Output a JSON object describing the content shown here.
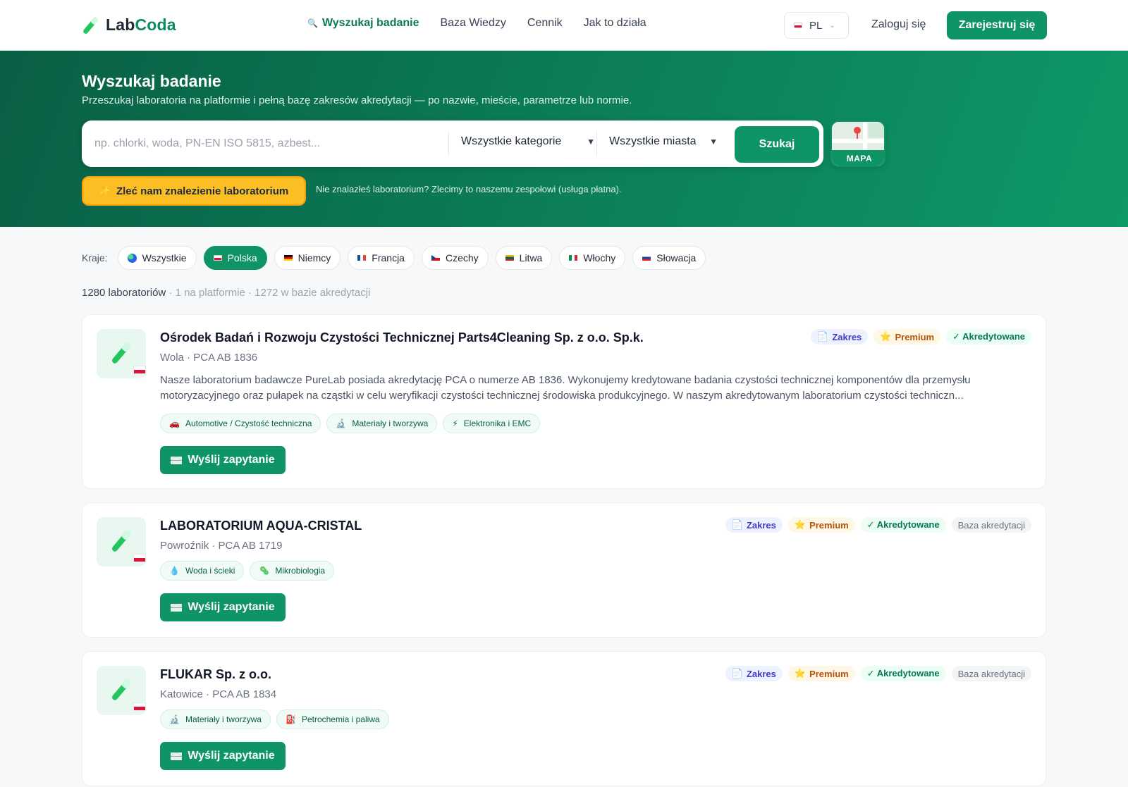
{
  "brand": {
    "name_a": "Lab",
    "name_b": "Coda"
  },
  "nav": {
    "links": [
      "Wyszukaj badanie",
      "Baza Wiedzy",
      "Cennik",
      "Jak to działa"
    ],
    "lang": "PL",
    "login": "Zaloguj się",
    "register": "Zarejestruj się"
  },
  "hero": {
    "title": "Wyszukaj badanie",
    "subtitle": "Przeszukaj laboratoria na platformie i pełną bazę zakresów akredytacji — po nazwie, mieście, parametrze lub normie.",
    "search_placeholder": "np. chlorki, woda, PN-EN ISO 5815, azbest...",
    "category_select": "Wszystkie kategorie",
    "city_select": "Wszystkie miasta",
    "search_button": "Szukaj",
    "map_label": "MAPA",
    "cta_button": "Zleć nam znalezienie laboratorium",
    "cta_note": "Nie znalazłeś laboratorium? Zlecimy to naszemu zespołowi (usługa płatna)."
  },
  "countries": {
    "label": "Kraje:",
    "items": [
      "Wszystkie",
      "Polska",
      "Niemcy",
      "Francja",
      "Czechy",
      "Litwa",
      "Włochy",
      "Słowacja"
    ],
    "active": "Polska"
  },
  "summary": {
    "total": "1280 laboratoriów",
    "details": " · 1 na platformie · 1272 w bazie akredytacji"
  },
  "badge_labels": {
    "zakres": "Zakres",
    "premium": "Premium",
    "akred": "✓ Akredytowane",
    "baza": "Baza akredytacji"
  },
  "send_label": "Wyślij zapytanie",
  "labs": [
    {
      "name": "Ośrodek Badań i Rozwoju Czystości Technicznej Parts4Cleaning Sp. z o.o. Sp.k.",
      "location": "Wola · PCA AB 1836",
      "description": "Nasze laboratorium badawcze PureLab posiada akredytację PCA o numerze AB 1836. Wykonujemy kredytowane badania czystości technicznej komponentów dla przemysłu motoryzacyjnego oraz pułapek na cząstki w celu weryfikacji czystości technicznej środowiska produkcyjnego. W naszym akredytowanym laboratorium czystości techniczn...",
      "tags": [
        "Automotive / Czystość techniczna",
        "Materiały i tworzywa",
        "Elektronika i EMC"
      ]
    },
    {
      "name": "LABORATORIUM AQUA-CRISTAL",
      "location": "Powroźnik · PCA AB 1719",
      "tags": [
        "Woda i ścieki",
        "Mikrobiologia"
      ]
    },
    {
      "name": "FLUKAR Sp. z o.o.",
      "location": "Katowice · PCA AB 1834",
      "tags": [
        "Materiały i tworzywa",
        "Petrochemia i paliwa"
      ]
    }
  ],
  "colors": {
    "primary": "#0f9565",
    "accent": "#fbbf24",
    "hero_dark": "#0a5f45"
  }
}
